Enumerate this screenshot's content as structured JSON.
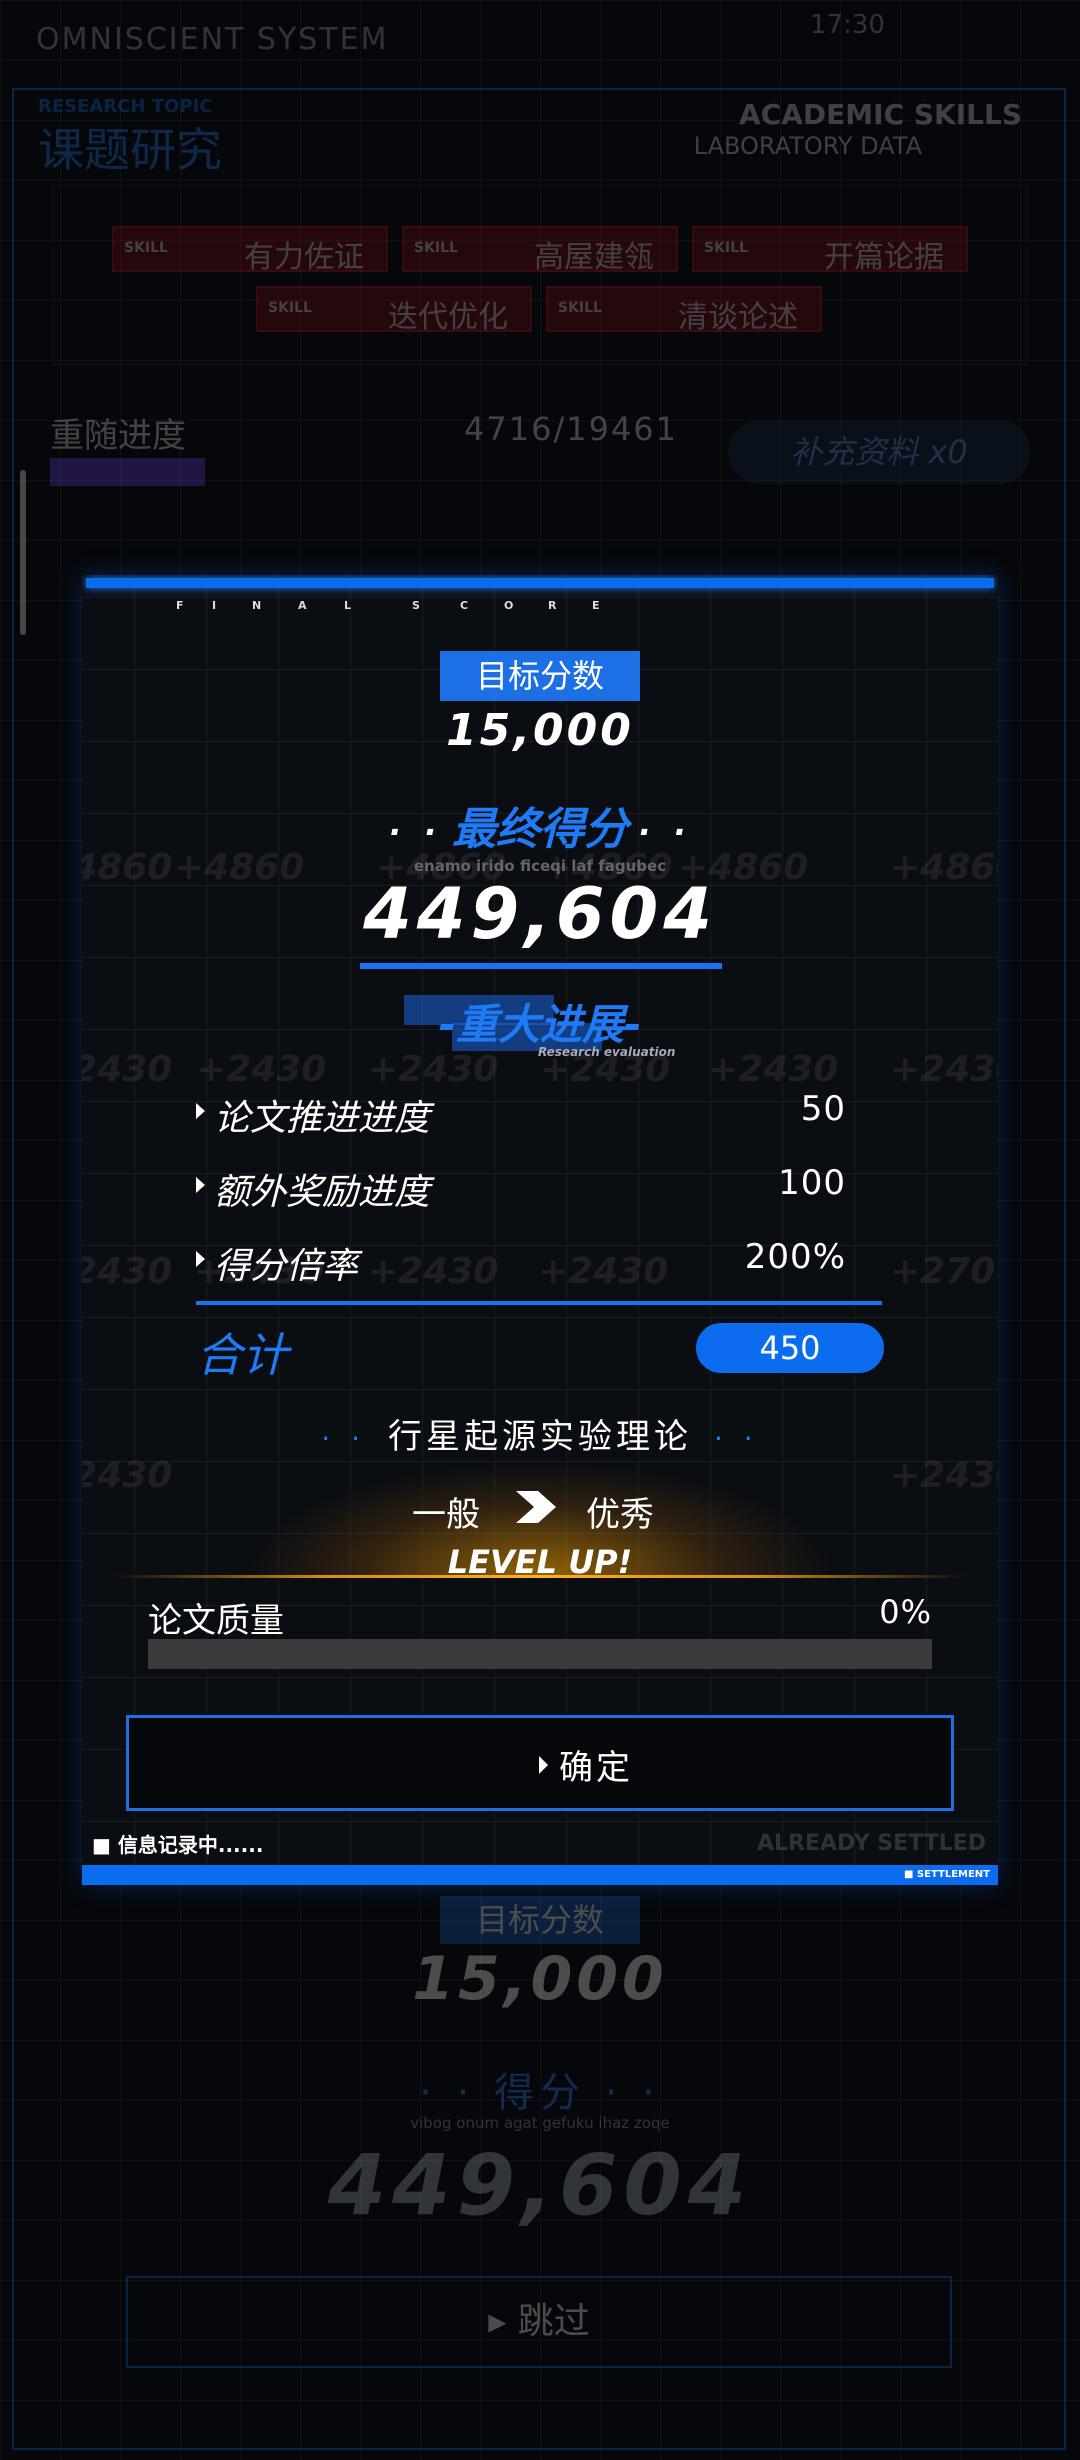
{
  "status_bar": {
    "app_name": "OMNISCIENT SYSTEM",
    "time": "17:30"
  },
  "header": {
    "research_topic_en": "RESEARCH TOPIC",
    "research_topic": "课题研究",
    "academic_skills": "ACADEMIC SKILLS",
    "laboratory_data": "LABORATORY DATA"
  },
  "skills": [
    {
      "tag": "SKILL",
      "name": "有力佐证"
    },
    {
      "tag": "SKILL",
      "name": "高屋建瓴"
    },
    {
      "tag": "SKILL",
      "name": "开篇论据"
    },
    {
      "tag": "SKILL",
      "name": "迭代优化"
    },
    {
      "tag": "SKILL",
      "name": "清谈论述"
    }
  ],
  "progress": {
    "label": "重随进度",
    "value": "4716/19461",
    "fraction": 0.24
  },
  "supplement_button": "补充资料 x0",
  "modal": {
    "final_score_letters": [
      "F",
      "I",
      "N",
      "A",
      "L",
      "S",
      "C",
      "O",
      "R",
      "E"
    ],
    "ghost_values": [
      "+4860",
      "+4860",
      "+4860",
      "+4860",
      "+4860",
      "+4860",
      "+2430",
      "+2430",
      "+2430",
      "+2430",
      "+2430",
      "+2430",
      "+2430",
      "+2430",
      "+2430",
      "+2430",
      "+270",
      "+2430",
      "+2430"
    ],
    "target_label": "目标分数",
    "target_value": "15,000",
    "final_title": "最终得分",
    "final_dots": "· ·",
    "final_subtitle": "enamo irido ficeqi laf fagubec",
    "final_score": "449,604",
    "eval_title": "-重大进展-",
    "eval_subtitle": "Research evaluation",
    "rows": [
      {
        "label": "论文推进进度",
        "value": "50"
      },
      {
        "label": "额外奖励进度",
        "value": "100"
      },
      {
        "label": "得分倍率",
        "value": "200%"
      }
    ],
    "sum_label": "合计",
    "sum_value": "450",
    "theory_title": "行星起源实验理论",
    "theory_dots": "· ·",
    "level_from": "一般",
    "level_to": "优秀",
    "level_up": "LEVEL UP!",
    "quality_label": "论文质量",
    "quality_value": "0%",
    "quality_fraction": 0,
    "confirm_label": "确定",
    "recording_text": "■ 信息记录中......",
    "settled_text": "ALREADY SETTLED",
    "settlement_text": "■ SETTLEMENT"
  },
  "background_panel": {
    "target_label": "目标分数",
    "target_value": "15,000",
    "score_title": "· · 得分 · ·",
    "score_subtitle": "vibog onum agat gefuku ihaz zoqe",
    "score_value": "449,604",
    "skip_label": "跳过"
  },
  "colors": {
    "accent": "#1f7af5",
    "skill_red": "#c2171b",
    "gold": "#ffb020"
  }
}
